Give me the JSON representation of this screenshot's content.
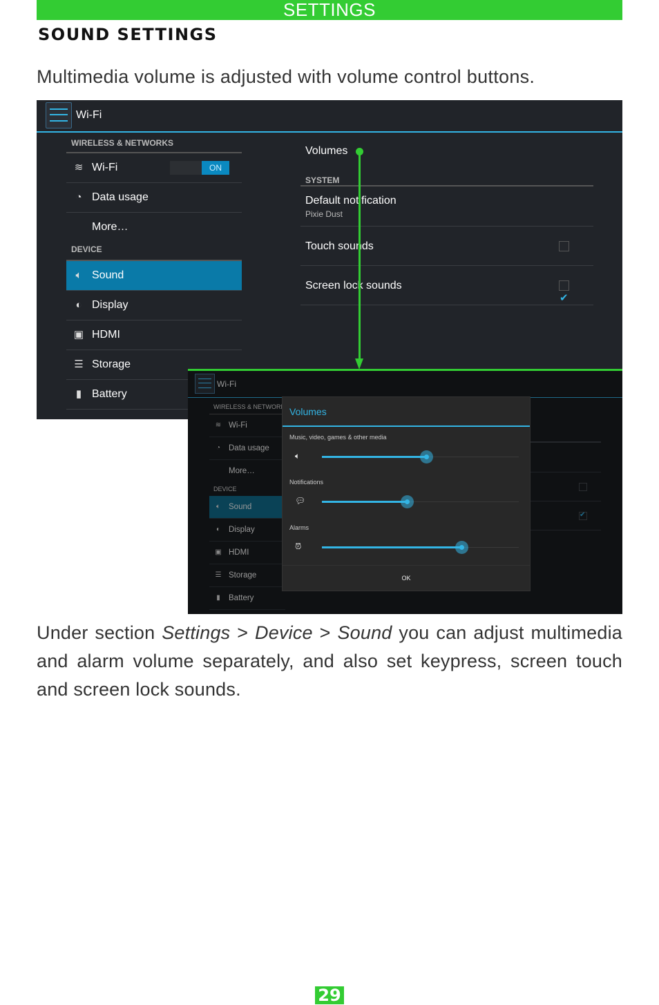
{
  "header": {
    "section": "SETTINGS"
  },
  "section_title": "SOUND SETTINGS",
  "intro_text": "Multimedia volume is adjusted with volume control buttons.",
  "outro": {
    "part1": "Under section ",
    "path1": "Settings",
    "sep1": " > ",
    "path2": "Device",
    "sep2": " > ",
    "path3": "Sound",
    "part2": " you can adjust multimedia and alarm volume separately, and also set keypress, screen touch and screen lock sounds."
  },
  "page_number": "29",
  "screenshot1": {
    "action_bar_title": "Wi-Fi",
    "left_pane": {
      "categories": [
        "WIRELESS & NETWORKS",
        "DEVICE"
      ],
      "items": [
        {
          "icon": "wifi-icon",
          "label": "Wi-Fi",
          "toggle": "ON"
        },
        {
          "icon": "data-usage-icon",
          "label": "Data usage"
        },
        {
          "icon": "",
          "label": "More…"
        },
        {
          "icon": "sound-icon",
          "label": "Sound",
          "selected": true
        },
        {
          "icon": "display-icon",
          "label": "Display"
        },
        {
          "icon": "hdmi-icon",
          "label": "HDMI"
        },
        {
          "icon": "storage-icon",
          "label": "Storage"
        },
        {
          "icon": "battery-icon",
          "label": "Battery"
        }
      ]
    },
    "right_pane": {
      "volumes_label": "Volumes",
      "system_category": "SYSTEM",
      "default_notification": {
        "title": "Default notification",
        "value": "Pixie Dust"
      },
      "touch_sounds": {
        "label": "Touch sounds",
        "checked": false
      },
      "screen_lock_sounds": {
        "label": "Screen lock sounds",
        "checked": true
      }
    }
  },
  "screenshot2": {
    "action_bar_title": "Wi-Fi",
    "left_pane": {
      "categories": [
        "WIRELESS & NETWORKS",
        "DEVICE"
      ],
      "items": [
        "Wi-Fi",
        "Data usage",
        "More…",
        "Sound",
        "Display",
        "HDMI",
        "Storage",
        "Battery"
      ]
    },
    "dialog": {
      "title": "Volumes",
      "sliders": [
        {
          "label": "Music, video, games & other media",
          "icon": "speaker-icon",
          "value": 0.53
        },
        {
          "label": "Notifications",
          "icon": "notification-icon",
          "value": 0.43
        },
        {
          "label": "Alarms",
          "icon": "alarm-clock-icon",
          "value": 0.71
        }
      ],
      "ok_label": "OK"
    }
  },
  "colors": {
    "accent_green": "#33cc33",
    "holo_blue": "#33b5e5",
    "selected_bg": "#0a7aa8"
  }
}
